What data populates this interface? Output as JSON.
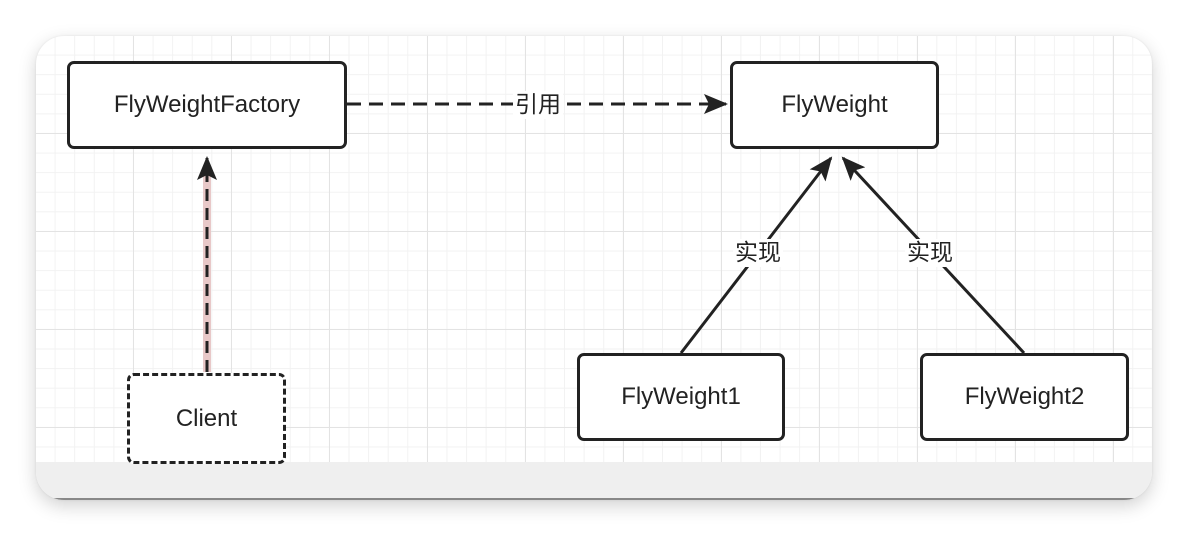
{
  "nodes": {
    "factory": "FlyWeightFactory",
    "flyweight": "FlyWeight",
    "client": "Client",
    "flyweight1": "FlyWeight1",
    "flyweight2": "FlyWeight2"
  },
  "edges": {
    "factory_to_flyweight": "引用",
    "flyweight1_to_flyweight": "实现",
    "flyweight2_to_flyweight": "实现"
  },
  "colors": {
    "stroke": "#222222",
    "client_dependency_highlight": "#e8c8c8"
  }
}
